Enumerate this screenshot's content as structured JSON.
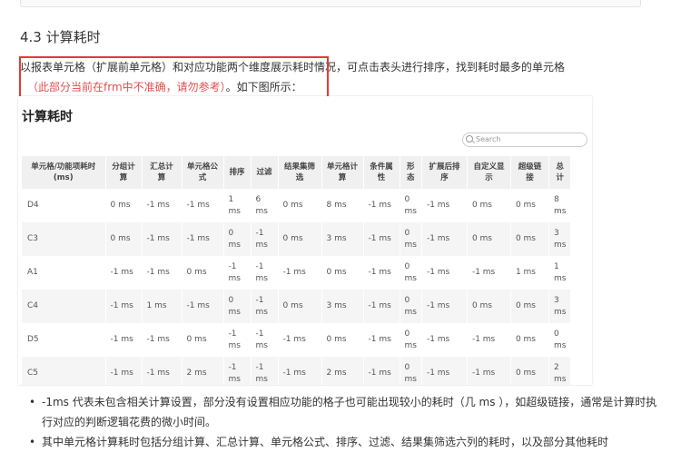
{
  "section": {
    "title": "4.3 计算耗时"
  },
  "intro": {
    "line1": "以报表单元格（扩展前单元格）和对应功能两个维度展示耗时情况，可点击表头进行排序，找到耗时最多的单元格",
    "note": "（此部分当前在frm中不准确，请勿参考）",
    "line2_suffix": "。如下图所示："
  },
  "screenshot": {
    "title": "计算耗时",
    "search_placeholder": "Search",
    "columns": [
      "单元格/功能项耗时(ms)",
      "分组计算",
      "汇总计算",
      "单元格公式",
      "排序",
      "过滤",
      "结果集筛选",
      "单元格计算",
      "条件属性",
      "形态",
      "扩展后排序",
      "自定义显示",
      "超级链接",
      "总计"
    ],
    "rows": [
      [
        "D4",
        "0 ms",
        "-1 ms",
        "-1 ms",
        "1 ms",
        "6 ms",
        "0 ms",
        "8 ms",
        "-1 ms",
        "0 ms",
        "-1 ms",
        "0 ms",
        "0 ms",
        "8 ms"
      ],
      [
        "C3",
        "0 ms",
        "-1 ms",
        "-1 ms",
        "0 ms",
        "-1 ms",
        "0 ms",
        "3 ms",
        "-1 ms",
        "0 ms",
        "-1 ms",
        "0 ms",
        "0 ms",
        "3 ms"
      ],
      [
        "A1",
        "-1 ms",
        "-1 ms",
        "0 ms",
        "-1 ms",
        "-1 ms",
        "-1 ms",
        "0 ms",
        "-1 ms",
        "0 ms",
        "-1 ms",
        "-1 ms",
        "1 ms",
        "1 ms"
      ],
      [
        "C4",
        "-1 ms",
        "1 ms",
        "-1 ms",
        "0 ms",
        "-1 ms",
        "0 ms",
        "3 ms",
        "-1 ms",
        "0 ms",
        "-1 ms",
        "0 ms",
        "0 ms",
        "3 ms"
      ],
      [
        "D5",
        "-1 ms",
        "-1 ms",
        "0 ms",
        "-1 ms",
        "-1 ms",
        "-1 ms",
        "0 ms",
        "-1 ms",
        "0 ms",
        "-1 ms",
        "-1 ms",
        "0 ms",
        "0 ms"
      ],
      [
        "C5",
        "-1 ms",
        "-1 ms",
        "2 ms",
        "-1 ms",
        "-1 ms",
        "-1 ms",
        "2 ms",
        "-1 ms",
        "0 ms",
        "-1 ms",
        "-1 ms",
        "0 ms",
        "2 ms"
      ]
    ]
  },
  "bullets": [
    "-1ms 代表未包含相关计算设置，部分没有设置相应功能的格子也可能出现较小的耗时（几 ms ），如超级链接，通常是计算时执行对应的判断逻辑花费的微小时间。",
    "其中单元格计算耗时包括分组计算、汇总计算、单元格公式、排序、过滤、结果集筛选六列的耗时，以及部分其他耗时"
  ],
  "colors": {
    "highlight_border": "#e53935",
    "note_text": "#e05050"
  }
}
